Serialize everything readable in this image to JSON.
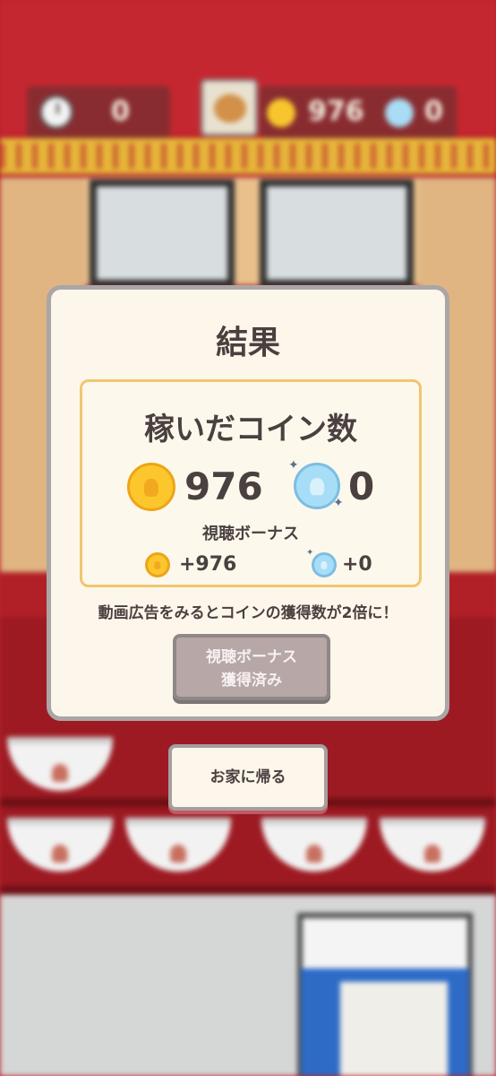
{
  "hud": {
    "time_value": "0",
    "coin_value": "976",
    "gem_value": "0"
  },
  "modal": {
    "title": "結果",
    "earned_title": "稼いだコイン数",
    "gold_coins": "976",
    "blue_coins": "0",
    "bonus_label": "視聴ボーナス",
    "bonus_gold": "+976",
    "bonus_blue": "+0",
    "ad_note": "動画広告をみるとコインの獲得数が2倍に！",
    "bonus_button_line1": "視聴ボーナス",
    "bonus_button_line2": "獲得済み"
  },
  "home_button": "お家に帰る",
  "icons": [
    "clock-icon",
    "gold-coin-icon",
    "blue-coin-icon",
    "player-avatar-icon"
  ],
  "colors": {
    "modal_bg": "#fcf7ea",
    "earned_border": "#f2c56e",
    "gold_coin": "#fbc72d",
    "blue_coin": "#a7ddf6",
    "disabled_button": "#b7a7a7",
    "text": "#4a4040"
  }
}
